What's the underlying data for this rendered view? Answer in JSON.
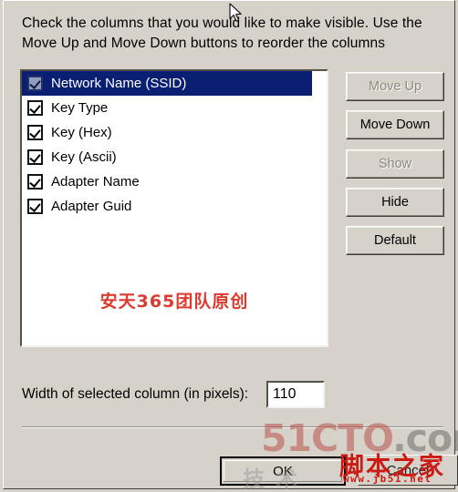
{
  "dialog": {
    "instructions_line1": "Check the columns that you would like to make visible. Use the",
    "instructions_line2": "Move Up and Move Down buttons to reorder the columns"
  },
  "columns_list": {
    "items": [
      {
        "label": "Network Name (SSID)",
        "checked": true,
        "selected": true
      },
      {
        "label": "Key Type",
        "checked": true,
        "selected": false
      },
      {
        "label": "Key (Hex)",
        "checked": true,
        "selected": false
      },
      {
        "label": "Key (Ascii)",
        "checked": true,
        "selected": false
      },
      {
        "label": "Adapter Name",
        "checked": true,
        "selected": false
      },
      {
        "label": "Adapter Guid",
        "checked": true,
        "selected": false
      }
    ]
  },
  "side_buttons": {
    "move_up": "Move Up",
    "move_down": "Move Down",
    "show": "Show",
    "hide": "Hide",
    "default": "Default"
  },
  "width_field": {
    "label": "Width of selected column (in pixels):",
    "value": "110"
  },
  "bottom_buttons": {
    "ok": "OK",
    "cancel": "Cancel"
  },
  "watermarks": {
    "list_red": "安天365团队原创",
    "site_51cto_name": "51CTO",
    "site_51cto_domain": ".com",
    "jb51_cn": "脚本之家",
    "jb51_url": "www.jb51.net",
    "jishu": "技术"
  },
  "colors": {
    "dialog_background": "#d6d2ca",
    "selection_blue": "#0a1e72",
    "watermark_red": "#cc1a14",
    "disabled_text": "#8d8a83"
  }
}
